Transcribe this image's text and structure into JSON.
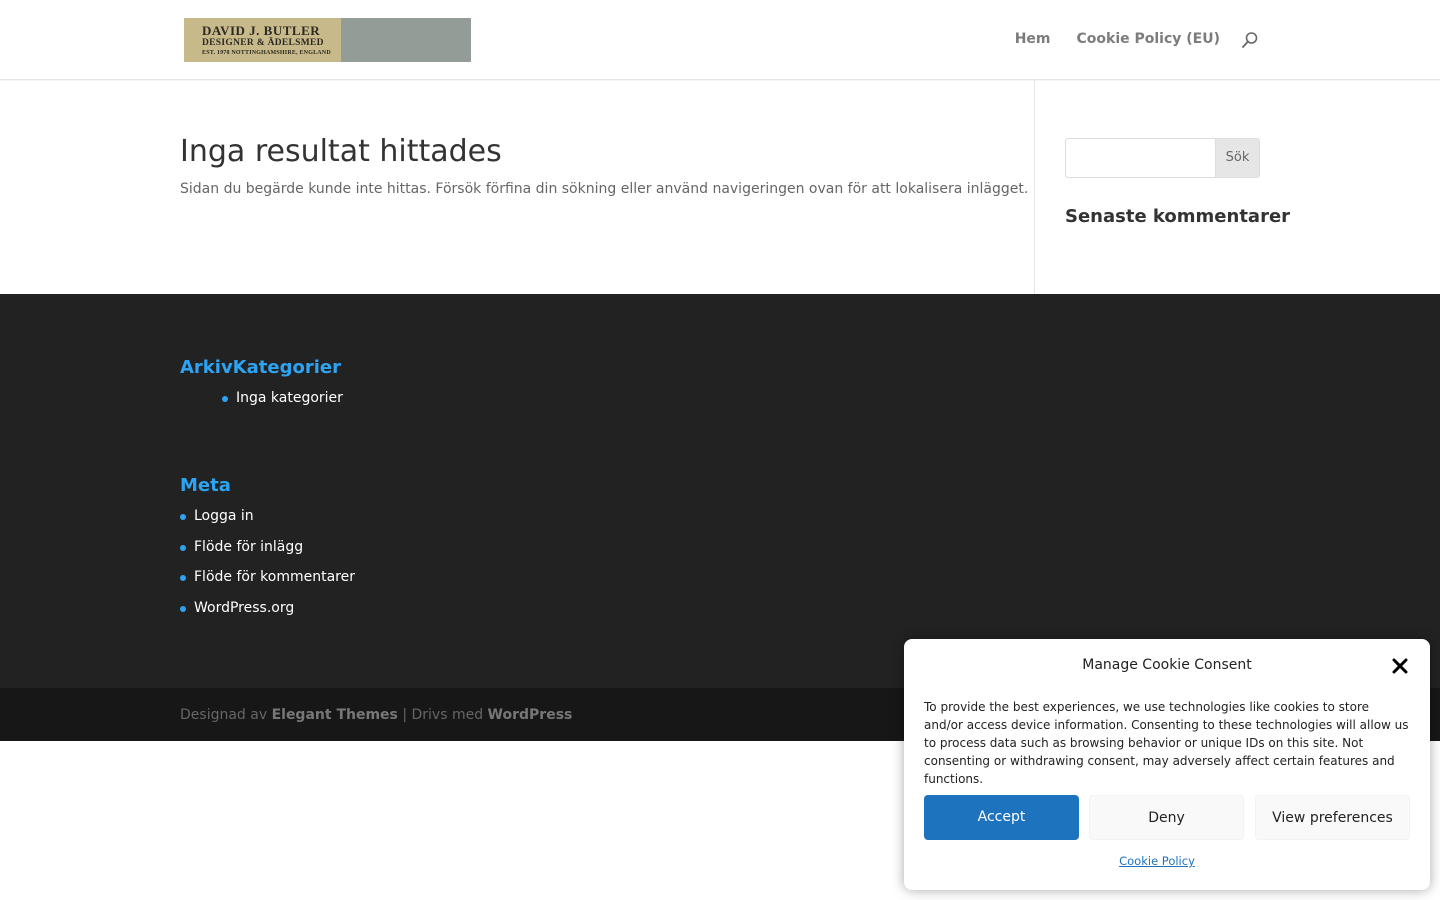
{
  "logo": {
    "line1": "DAVID J. BUTLER",
    "line2": "DESIGNER & ÄDELSMED",
    "line3": "EST. 1978 NOTTINGHAMSHIRE, ENGLAND"
  },
  "nav": {
    "items": [
      "Hem",
      "Cookie Policy (EU)"
    ],
    "search_icon": "search-icon"
  },
  "main": {
    "title": "Inga resultat hittades",
    "text": "Sidan du begärde kunde inte hittas. Försök förfina din sökning eller använd navigeringen ovan för att lokalisera inlägget."
  },
  "sidebar": {
    "search_input_value": "",
    "search_button": "Sök",
    "heading": "Senaste kommentarer"
  },
  "footer": {
    "heading1": "ArkivKategorier",
    "categories": [
      "Inga kategorier"
    ],
    "heading2": "Meta",
    "meta_items": [
      "Logga in",
      "Flöde för inlägg",
      "Flöde för kommentarer",
      "WordPress.org"
    ],
    "credits": {
      "designed_by": "Designad av",
      "designer": "Elegant Themes",
      "separator": "| Drivs med",
      "platform": "WordPress"
    }
  },
  "cookie": {
    "title": "Manage Cookie Consent",
    "text": "To provide the best experiences, we use technologies like cookies to store and/or access device information. Consenting to these technologies will allow us to process data such as browsing behavior or unique IDs on this site. Not consenting or withdrawing consent, may adversely affect certain features and functions.",
    "accept": "Accept",
    "deny": "Deny",
    "preferences": "View preferences",
    "policy_link": "Cookie Policy",
    "close_icon": "close-icon"
  },
  "colors": {
    "accent": "#2ea3f2",
    "footer_bg": "#222222",
    "bottom_bar_bg": "#171717",
    "accept_button": "#1e73be"
  }
}
